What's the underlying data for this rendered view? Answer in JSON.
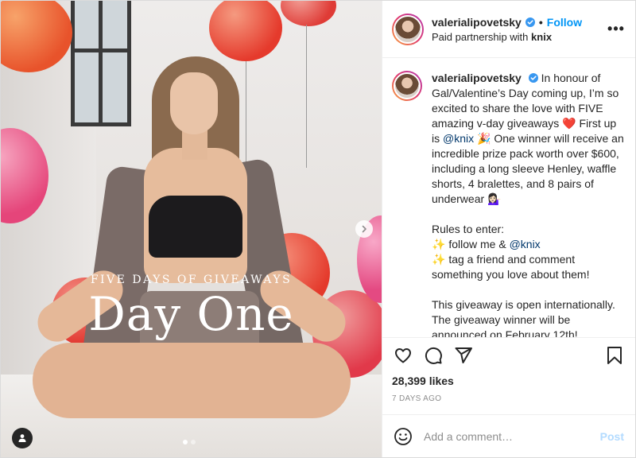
{
  "header": {
    "username": "valerialipovetsky",
    "follow_label": "Follow",
    "separator": "•",
    "paid_prefix": "Paid partnership with",
    "partner": "knix",
    "more_label": "•••"
  },
  "media": {
    "overlay_subtitle": "FIVE DAYS OF GIVEAWAYS",
    "overlay_title": "Day One",
    "carousel_total": 2,
    "carousel_active": 1
  },
  "caption": {
    "username": "valerialipovetsky",
    "p1_a": "In honour of Gal/Valentine’s Day coming up, I’m so excited to share the love with FIVE amazing v-day giveaways ",
    "p1_heart": "❤️",
    "p1_b": " First up is ",
    "p1_mention": "@knix",
    "p1_c": " 🎉 One winner will receive an incredible prize pack worth over $600, including a long sleeve Henley, waffle shorts, 4 bralettes, and 8 pairs of underwear 💁🏻‍♀️",
    "rules_title": "Rules to enter:",
    "rule1_a": "✨ follow me & ",
    "rule1_mention": "@knix",
    "rule2": "✨ tag a friend and comment something you love about them!",
    "p3": "This giveaway is open internationally. The giveaway winner will be announced on February 12th!"
  },
  "stats": {
    "likes": "28,399 likes",
    "time_ago": "7 DAYS AGO"
  },
  "comment": {
    "placeholder": "Add a comment…",
    "post_label": "Post"
  },
  "colors": {
    "link_blue": "#0095f6",
    "mention_blue": "#00376b",
    "post_disabled": "#b3dbff",
    "balloon_red": "#e8392f",
    "balloon_pink": "#e94b7a"
  }
}
